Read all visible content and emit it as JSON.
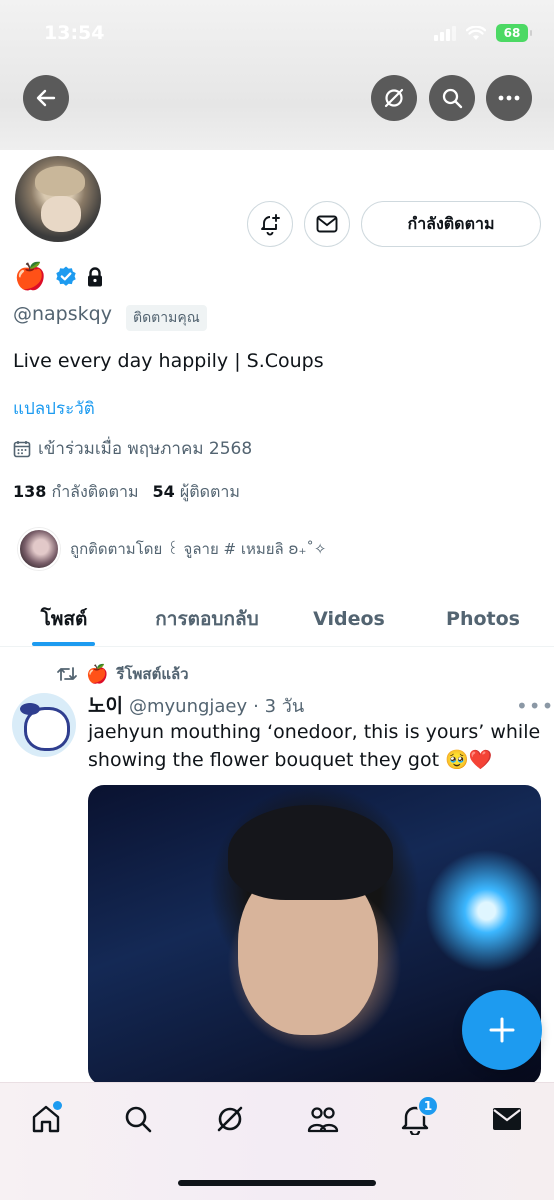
{
  "status_bar": {
    "time": "13:54",
    "battery": "68"
  },
  "profile": {
    "name_emoji": "🍎",
    "handle": "@napskqy",
    "follows_you": "ติดตามคุณ",
    "bio": "Live every day happily | S.Coups",
    "translate_bio": "แปลประวัติ",
    "joined": "เข้าร่วมเมื่อ พฤษภาคม 2568",
    "following_count": "138",
    "following_label": "กำลังติดตาม",
    "followers_count": "54",
    "followers_label": "ผู้ติดตาม",
    "followed_by": "ถูกติดตามโดย ꒰ จูลาย # เหมยลิ ʚ₊˚✧"
  },
  "actions": {
    "follow_button": "กำลังติดตาม"
  },
  "tabs": [
    {
      "label": "โพสต์"
    },
    {
      "label": "การตอบกลับ"
    },
    {
      "label": "Videos"
    },
    {
      "label": "Photos"
    }
  ],
  "post": {
    "repost_emoji": "🍎",
    "repost_label": "รีโพสต์แล้ว",
    "author_name": "노이",
    "author_handle": "@myungjaey",
    "time": "· 3 วัน",
    "text": "jaehyun mouthing ‘onedoor, this is yours’ while showing the flower bouquet they got 🥹❤️"
  },
  "bottom_nav": {
    "notifications_badge": "1"
  },
  "colors": {
    "accent": "#1d9bf0",
    "text_secondary": "#536471"
  },
  "icons": [
    "back-arrow-icon",
    "grok-icon",
    "search-icon",
    "more-icon",
    "notify-bell-icon",
    "message-icon",
    "verified-icon",
    "lock-icon",
    "calendar-icon",
    "repost-icon",
    "plus-icon",
    "home-icon",
    "communities-icon",
    "bell-icon",
    "mail-icon"
  ]
}
